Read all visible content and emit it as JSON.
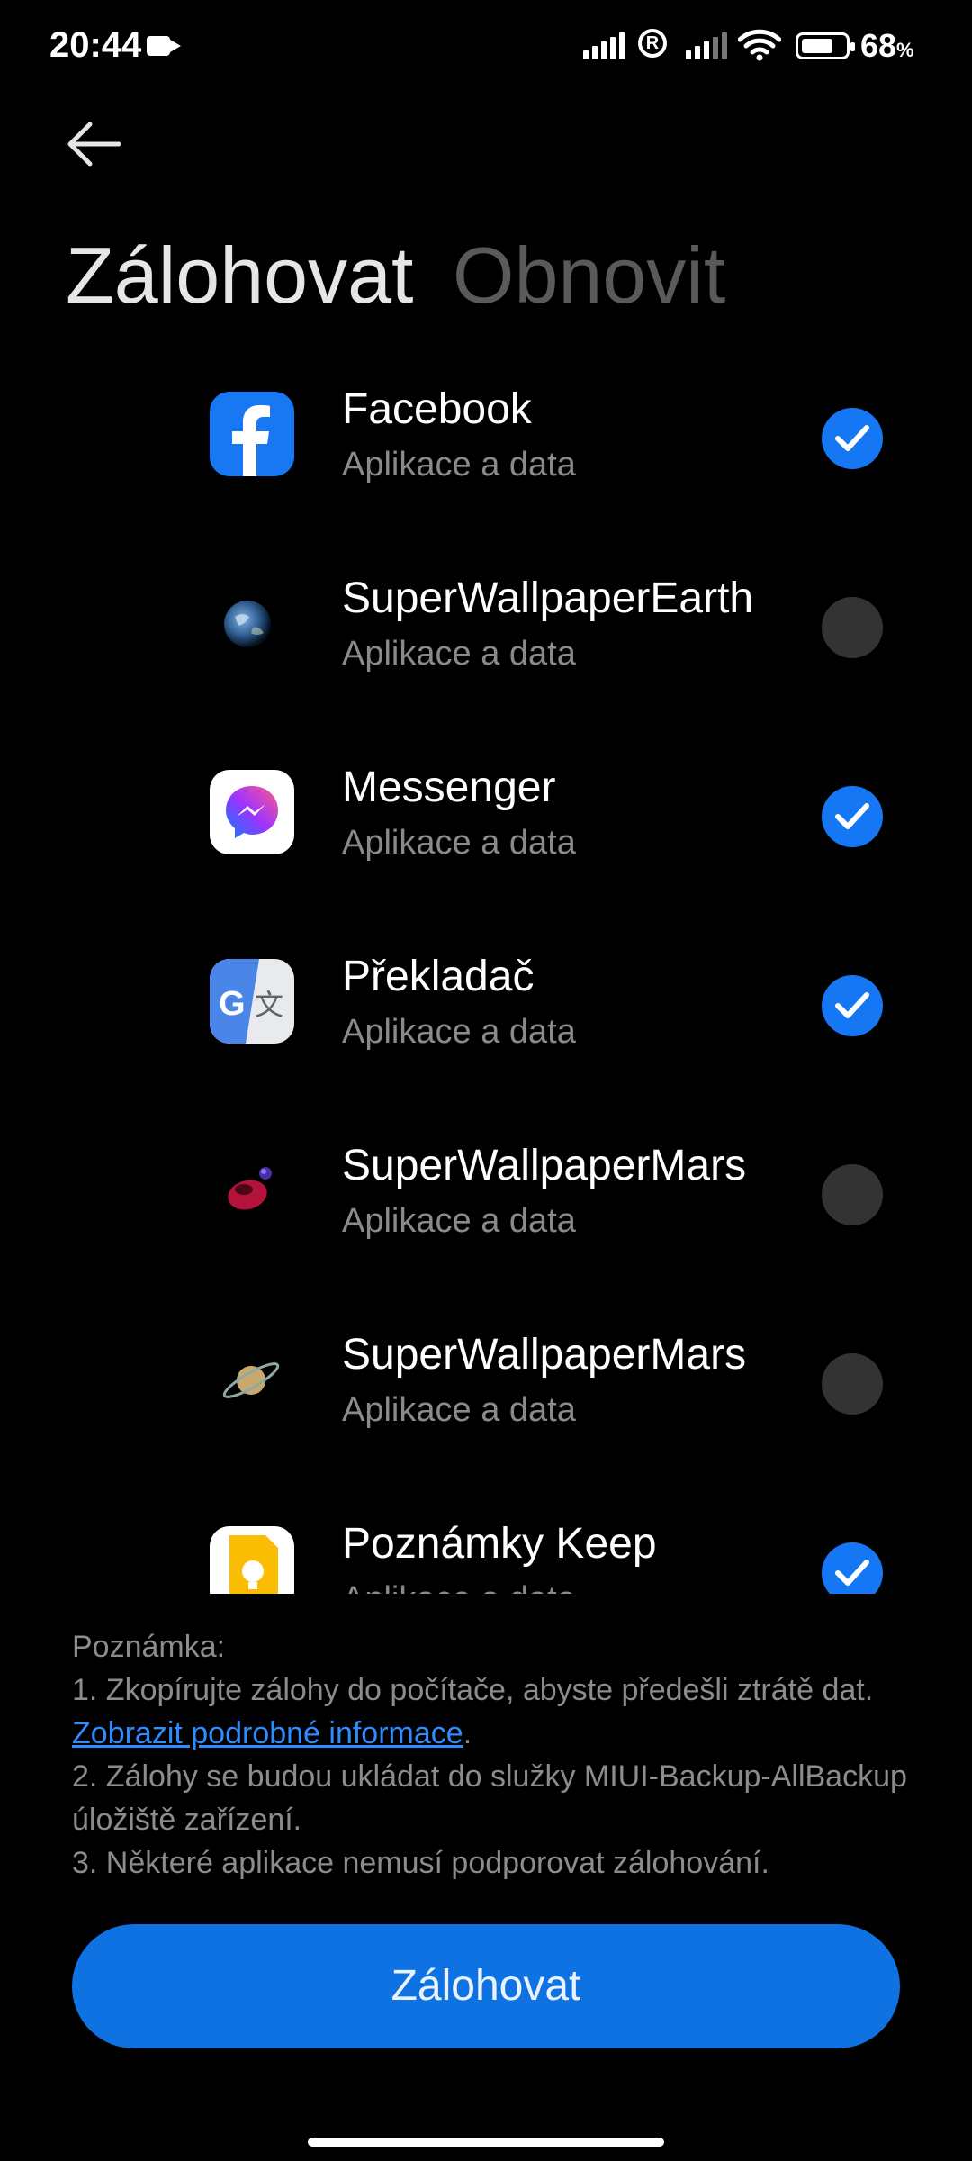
{
  "status_bar": {
    "time": "20:44",
    "battery_percent": "68",
    "battery_unit": "%"
  },
  "tabs": [
    {
      "label": "Zálohovat",
      "active": true
    },
    {
      "label": "Obnovit",
      "active": false
    }
  ],
  "apps": [
    {
      "name": "Facebook",
      "subtitle": "Aplikace a data",
      "checked": true,
      "icon": "facebook-icon"
    },
    {
      "name": "SuperWallpaperEarth",
      "subtitle": "Aplikace a data",
      "checked": false,
      "icon": "earth-icon"
    },
    {
      "name": "Messenger",
      "subtitle": "Aplikace a data",
      "checked": true,
      "icon": "messenger-icon"
    },
    {
      "name": "Překladač",
      "subtitle": "Aplikace a data",
      "checked": true,
      "icon": "translate-icon"
    },
    {
      "name": "SuperWallpaperMars",
      "subtitle": "Aplikace a data",
      "checked": false,
      "icon": "mars-icon"
    },
    {
      "name": "SuperWallpaperMars",
      "subtitle": "Aplikace a data",
      "checked": false,
      "icon": "saturn-icon"
    },
    {
      "name": "Poznámky Keep",
      "subtitle": "Aplikace a data",
      "checked": true,
      "icon": "keep-icon"
    }
  ],
  "note": {
    "heading": "Poznámka:",
    "line1_prefix": "1. Zkopírujte zálohy do počítače, abyste předešli ztrátě dat. ",
    "line1_link": "Zobrazit podrobné informace",
    "line1_suffix": ".",
    "line2": "2. Zálohy se budou ukládat do služky MIUI-Backup-AllBackup úložiště zařízení.",
    "line3": "3. Některé aplikace nemusí podporovat zálohování."
  },
  "primary_button": "Zálohovat",
  "colors": {
    "accent": "#1677f5",
    "button": "#0f72e3",
    "link": "#2f8cff",
    "unchecked": "#333333"
  }
}
